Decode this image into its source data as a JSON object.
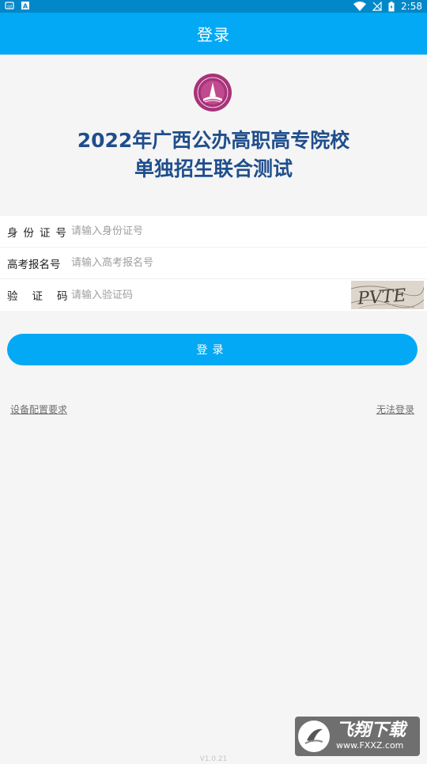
{
  "status_bar": {
    "time": "2:58",
    "icons": [
      "notification-icon",
      "font-icon",
      "wifi-icon",
      "no-signal-icon",
      "battery-icon"
    ]
  },
  "app_bar": {
    "title": "登录"
  },
  "header": {
    "line1": "2022年广西公办高职高专院校",
    "line2": "单独招生联合测试"
  },
  "form": {
    "id_label": "身份证号",
    "id_placeholder": "请输入身份证号",
    "exam_label": "高考报名号",
    "exam_placeholder": "请输入高考报名号",
    "captcha_label": "验证码",
    "captcha_placeholder": "请输入验证码",
    "captcha_text": "PVTE"
  },
  "login_button": "登录",
  "links": {
    "device": "设备配置要求",
    "cannot_login": "无法登录"
  },
  "version": "V1.0.21",
  "watermark": {
    "main": "飞翔下载",
    "url": "www.FXXZ.com"
  },
  "colors": {
    "primary": "#03a9f4",
    "status_bar": "#0288c8",
    "headline": "#1f4e8c",
    "logo": "#a8337a"
  }
}
